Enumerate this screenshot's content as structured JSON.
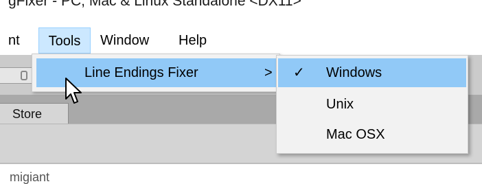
{
  "window": {
    "title": "gFixer - PC, Mac & Linux Standalone <DX11>"
  },
  "menubar": {
    "items": [
      {
        "label": "nt"
      },
      {
        "label": "Tools"
      },
      {
        "label": "Window"
      },
      {
        "label": "Help"
      }
    ]
  },
  "tools_menu": {
    "items": [
      {
        "label": "Line Endings Fixer",
        "submenu_arrow": ">"
      }
    ]
  },
  "line_endings_submenu": {
    "checkmark": "✓",
    "items": [
      {
        "label": "Windows",
        "checked": true
      },
      {
        "label": "Unix",
        "checked": false
      },
      {
        "label": "Mac OSX",
        "checked": false
      }
    ]
  },
  "editor": {
    "tab_label": "Store",
    "footer_text": "migiant"
  },
  "colors": {
    "menu_highlight": "#91c9f7",
    "menubar_active": "#cce8ff",
    "menu_background": "#f2f2f2"
  },
  "icons": {
    "cursor": "mouse-pointer-icon",
    "check": "checkmark-icon",
    "submenu": "chevron-right-icon",
    "toolbar": "toolbar-button-icon"
  }
}
